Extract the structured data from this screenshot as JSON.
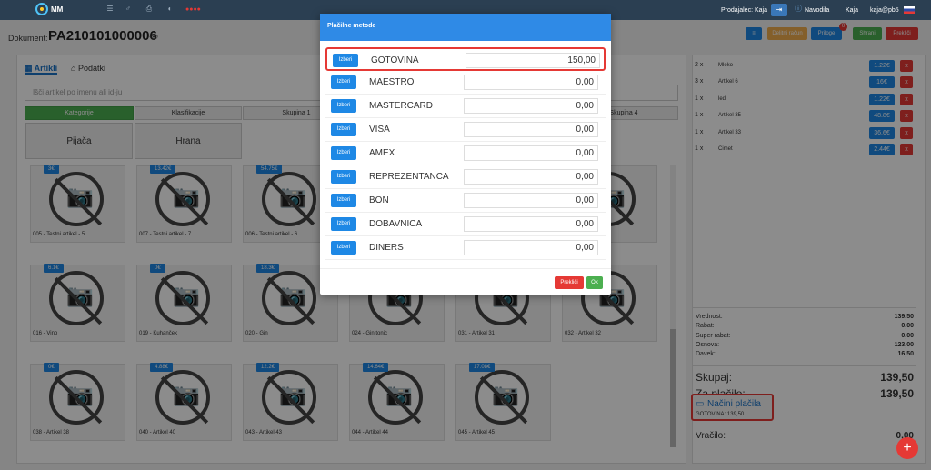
{
  "topbar": {
    "brand": "MM",
    "red_text": "●●●●",
    "seller_label": "Prodajalec: Kaja",
    "navodila": "Navodila",
    "user1": "Kaja",
    "user2": "kaja@pb5"
  },
  "document": {
    "label": "Dokument:",
    "number": "PA210101000006"
  },
  "actions": {
    "btn_blue_icon": "≡",
    "btn_orange": "Delitni račun",
    "btn_priloge": "Priloge",
    "priloge_badge": "0",
    "btn_shrani": "Shrani",
    "btn_preklici": "Prekliči"
  },
  "tabs": [
    {
      "label": "Artikli",
      "icon": "grid-icon"
    },
    {
      "label": "Podatki",
      "icon": "home-icon"
    }
  ],
  "search": {
    "placeholder": "Išči artikel po imenu ali id-ju"
  },
  "categories": [
    "Kategorije",
    "Klasifikacije",
    "Skupina 1",
    "Skupina 4"
  ],
  "bigcats": [
    "Pijača",
    "Hrana"
  ],
  "products": [
    {
      "price": "3€",
      "name": "005 - Testni artikel - 5"
    },
    {
      "price": "13.42€",
      "name": "007 - Testni artikel - 7"
    },
    {
      "price": "54.75€",
      "name": "006 - Testni artikel - 6"
    },
    {
      "price": "",
      "name": ""
    },
    {
      "price": "",
      "name": ""
    },
    {
      "price": "",
      "name": ""
    },
    {
      "price": "6.1€",
      "name": "016 - Vino"
    },
    {
      "price": "0€",
      "name": "019 - Kuhanček"
    },
    {
      "price": "18.3€",
      "name": "020 - Gin"
    },
    {
      "price": "",
      "name": "024 - Gin tonic"
    },
    {
      "price": "",
      "name": "031 - Artikel 31"
    },
    {
      "price": "",
      "name": "032 - Artikel 32"
    },
    {
      "price": "0€",
      "name": "038 - Artikel 38"
    },
    {
      "price": "4.88€",
      "name": "040 - Artikel 40"
    },
    {
      "price": "12.2€",
      "name": "043 - Artikel 43"
    },
    {
      "price": "14.64€",
      "name": "044 - Artikel 44"
    },
    {
      "price": "17.08€",
      "name": "045 - Artikel 45"
    }
  ],
  "basket": [
    {
      "qty": "2 x",
      "name": "Mleko",
      "price": "1.22€"
    },
    {
      "qty": "3 x",
      "name": "Artikel 6",
      "price": "16€"
    },
    {
      "qty": "1 x",
      "name": "led",
      "price": "1.22€"
    },
    {
      "qty": "1 x",
      "name": "Artikel 35",
      "price": "48.8€"
    },
    {
      "qty": "1 x",
      "name": "Artikel 33",
      "price": "36.6€"
    },
    {
      "qty": "1 x",
      "name": "Cimet",
      "price": "2.44€"
    }
  ],
  "remove_label": "x",
  "summary": [
    {
      "label": "Vrednost:",
      "value": "139,50"
    },
    {
      "label": "Rabat:",
      "value": "0,00"
    },
    {
      "label": "Super rabat:",
      "value": "0,00"
    },
    {
      "label": "Osnova:",
      "value": "123,00"
    },
    {
      "label": "Davek:",
      "value": "16,50"
    }
  ],
  "totals": {
    "skupaj_label": "Skupaj:",
    "skupaj_value": "139,50",
    "zaplacilo_label": "Za plačilo:",
    "zaplacilo_value": "139,50",
    "nacini_label": "Načini plačila",
    "nacini_value": "GOTOVINA: 139,50",
    "vracilo_label": "Vračilo:",
    "vracilo_value": "0,00"
  },
  "modal": {
    "title": "Plačilne metode",
    "select_label": "Izberi",
    "methods": [
      {
        "name": "GOTOVINA",
        "value": "150,00"
      },
      {
        "name": "MAESTRO",
        "value": "0,00"
      },
      {
        "name": "MASTERCARD",
        "value": "0,00"
      },
      {
        "name": "VISA",
        "value": "0,00"
      },
      {
        "name": "AMEX",
        "value": "0,00"
      },
      {
        "name": "REPREZENTANCA",
        "value": "0,00"
      },
      {
        "name": "BON",
        "value": "0,00"
      },
      {
        "name": "DOBAVNICA",
        "value": "0,00"
      },
      {
        "name": "DINERS",
        "value": "0,00"
      }
    ],
    "cancel_label": "Prekliči",
    "ok_label": "Ok"
  },
  "fab_label": "+",
  "colors": {
    "primary": "#1e88e5",
    "danger": "#e53935",
    "success": "#4caf50",
    "header": "#2b3f52",
    "highlight": "#e53935"
  }
}
